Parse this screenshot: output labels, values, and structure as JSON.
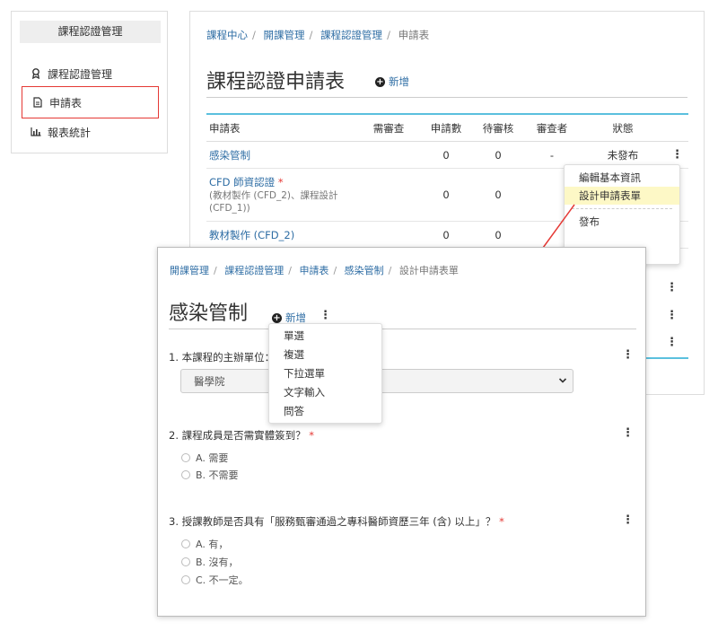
{
  "sidebar": {
    "title": "課程認證管理",
    "items": [
      {
        "label": "課程認證管理",
        "icon": "award-icon"
      },
      {
        "label": "申請表",
        "icon": "document-icon"
      },
      {
        "label": "報表統計",
        "icon": "bar-chart-icon"
      }
    ]
  },
  "main": {
    "breadcrumb": [
      "課程中心",
      "開課管理",
      "課程認證管理",
      "申請表"
    ],
    "title": "課程認證申請表",
    "add_label": "新增",
    "table": {
      "headers": [
        "申請表",
        "需審查",
        "申請數",
        "待審核",
        "審查者",
        "狀態"
      ],
      "rows": [
        {
          "name": "感染管制",
          "required": "",
          "sub": "",
          "review": "",
          "count": "0",
          "pending": "0",
          "reviewer": "-",
          "status": "未發布"
        },
        {
          "name": "CFD 師資認證",
          "required": "*",
          "sub": "(教材製作 (CFD_2)、課程設計 (CFD_1))",
          "review": "",
          "count": "0",
          "pending": "0",
          "reviewer": "",
          "status": ""
        },
        {
          "name": "教材製作 (CFD_2)",
          "required": "",
          "sub": "",
          "review": "",
          "count": "0",
          "pending": "0",
          "reviewer": "",
          "status": ""
        }
      ]
    },
    "row_menu": {
      "items": [
        "編輯基本資訊",
        "設計申請表單"
      ],
      "extra": "發布",
      "highlighted": 1
    },
    "more_glyph": "⋮"
  },
  "form": {
    "breadcrumb": [
      "開課管理",
      "課程認證管理",
      "申請表",
      "感染管制",
      "設計申請表單"
    ],
    "title": "感染管制",
    "add_label": "新增",
    "add_menu": [
      "單選",
      "複選",
      "下拉選單",
      "文字輸入",
      "問答"
    ],
    "questions": [
      {
        "label": "1. 本課程的主辦單位：",
        "type": "select",
        "value": "醫學院",
        "required": ""
      },
      {
        "label": "2. 課程成員是否需實體簽到？",
        "required": "*",
        "options": [
          "A. 需要",
          "B. 不需要"
        ]
      },
      {
        "label": "3. 授課教師是否具有「服務甄審通過之專科醫師資歷三年 (含) 以上」？",
        "required": "*",
        "options": [
          "A. 有，",
          "B. 沒有，",
          "C. 不一定。"
        ]
      }
    ]
  },
  "colors": {
    "accent": "#2e6da4",
    "highlight": "#fdf8c6",
    "outline": "#e53935",
    "table_top": "#5bc0de"
  }
}
